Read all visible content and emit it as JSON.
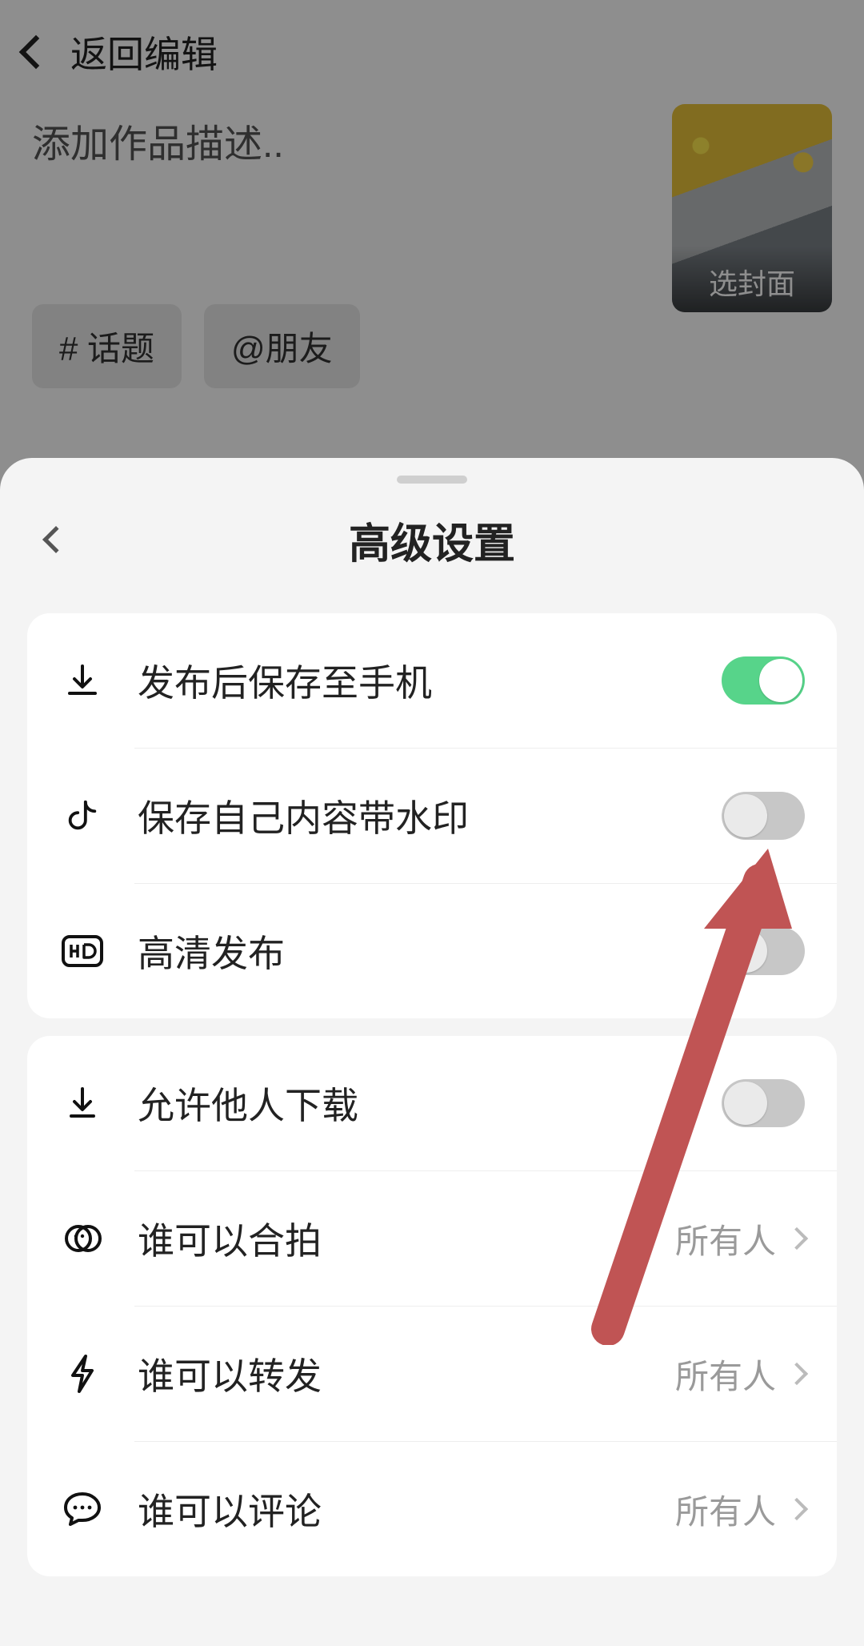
{
  "background": {
    "back_label": "返回编辑",
    "description_placeholder": "添加作品描述..",
    "chip_topic": "# 话题",
    "chip_friend": "@朋友",
    "cover_label": "选封面"
  },
  "sheet": {
    "title": "高级设置",
    "group1": {
      "save_to_phone": {
        "label": "发布后保存至手机",
        "on": true
      },
      "watermark": {
        "label": "保存自己内容带水印",
        "on": false
      },
      "hd_publish": {
        "label": "高清发布",
        "on": false
      }
    },
    "group2": {
      "allow_download": {
        "label": "允许他人下载",
        "on": false
      },
      "who_duet": {
        "label": "谁可以合拍",
        "value": "所有人"
      },
      "who_share": {
        "label": "谁可以转发",
        "value": "所有人"
      },
      "who_comment": {
        "label": "谁可以评论",
        "value": "所有人"
      }
    }
  },
  "icons": {
    "download": "download-icon",
    "douyin": "douyin-icon",
    "hd": "hd-icon",
    "download2": "download-simple-icon",
    "duet": "duet-icon",
    "share": "lightning-icon",
    "comment": "comment-icon"
  }
}
